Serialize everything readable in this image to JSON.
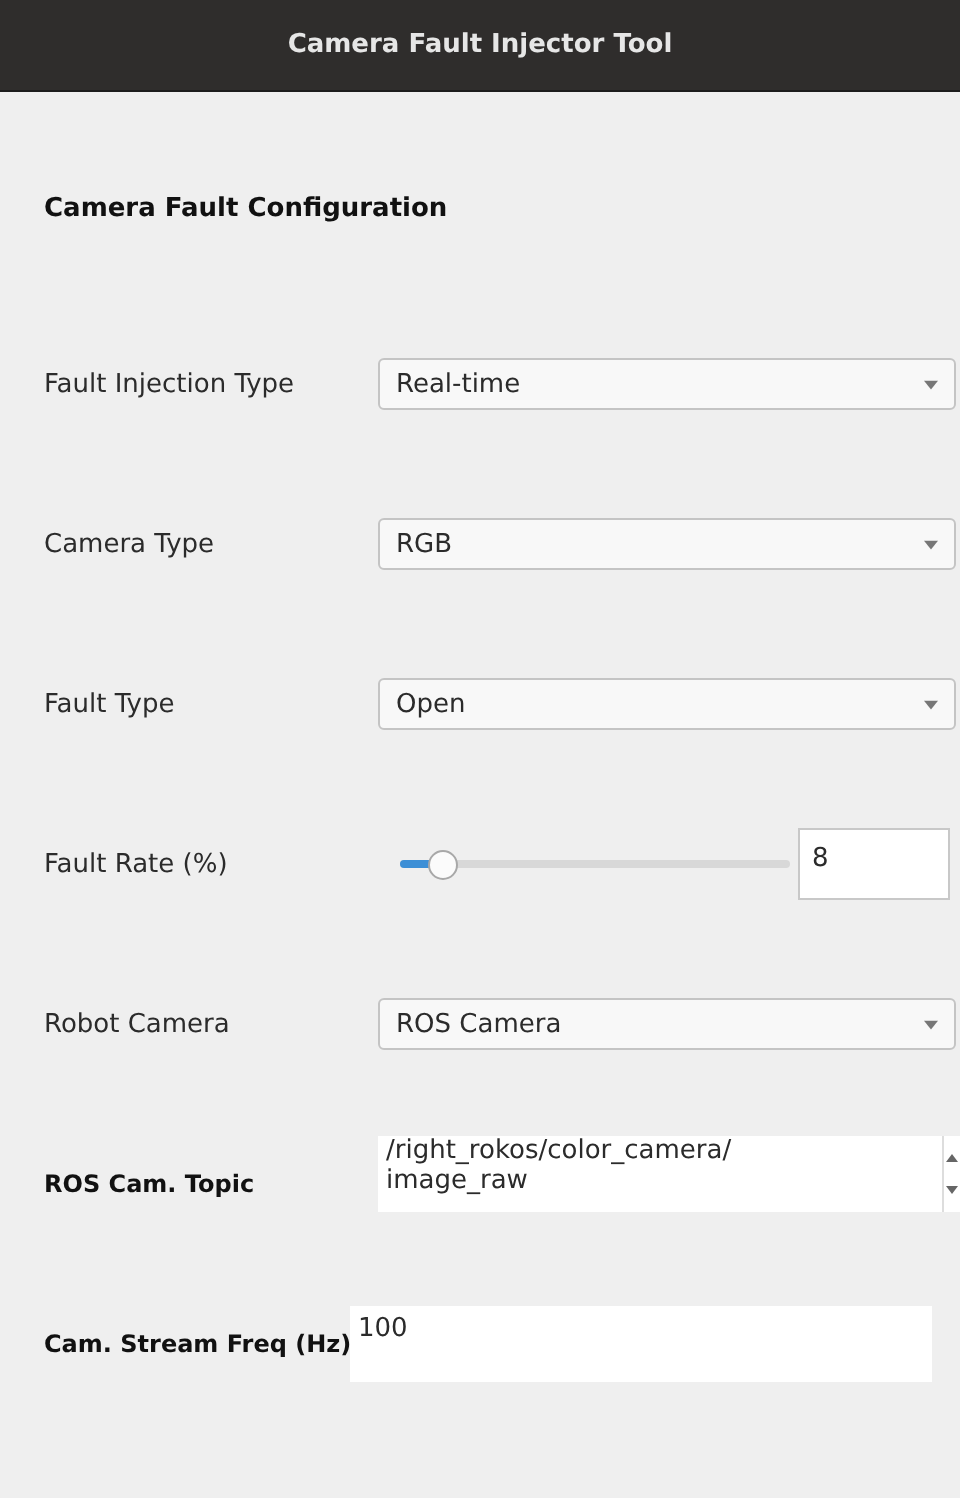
{
  "window": {
    "title": "Camera Fault Injector Tool"
  },
  "section_title": "Camera Fault Configuration",
  "fields": [
    {
      "kind": "combo",
      "label": "Fault Injection Type",
      "label_bold": false,
      "value": "Real-time"
    },
    {
      "kind": "combo",
      "label": "Camera Type",
      "label_bold": false,
      "value": "RGB"
    },
    {
      "kind": "combo",
      "label": "Fault Type",
      "label_bold": false,
      "value": "Open"
    },
    {
      "kind": "slider",
      "label": "Fault Rate (%)",
      "label_bold": false,
      "level": 0.08,
      "value": "8"
    },
    {
      "kind": "combo",
      "label": "Robot Camera",
      "label_bold": false,
      "value": "ROS Camera"
    },
    {
      "kind": "textarea",
      "label": "ROS Cam. Topic",
      "label_bold": true,
      "value": "/right_rokos/color_camera/\nimage_raw"
    },
    {
      "kind": "text",
      "label": "Cam. Stream Freq (Hz)",
      "label_bold": true,
      "value": "100"
    }
  ]
}
